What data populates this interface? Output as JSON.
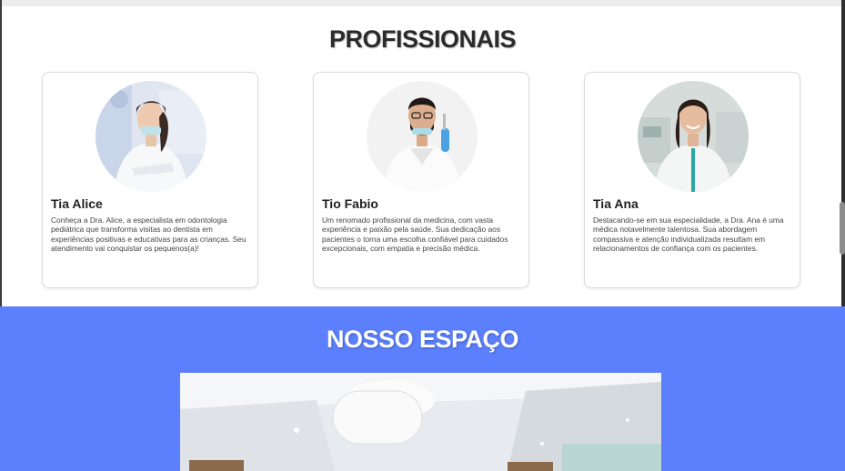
{
  "professionals": {
    "title": "PROFISSIONAIS",
    "cards": [
      {
        "name": "Tia Alice",
        "description": "Conheça a Dra. Alice, a especialista em odontologia pediátrica que transforma visitas ao dentista em experiências positivas e educativas para as crianças. Seu atendimento vai conquistar os pequenos(a)!",
        "photo_icon": "dentist-photo"
      },
      {
        "name": "Tio Fabio",
        "description": "Um renomado profissional da medicina, com vasta experiência e paixão pela saúde. Sua dedicação aos pacientes o torna uma escolha confiável para cuidados excepcionais, com empatia e precisão médica.",
        "photo_icon": "dentist-photo"
      },
      {
        "name": "Tia Ana",
        "description": "Destacando-se em sua especialidade, a Dra. Ana é uma médica notavelmente talentosa. Sua abordagem compassiva e atenção individualizada resultam em relacionamentos de confiança com os pacientes.",
        "photo_icon": "dentist-photo"
      }
    ]
  },
  "space": {
    "title": "NOSSO ESPAÇO",
    "photo_icon": "clinic-interior-photo"
  },
  "colors": {
    "accent_blue": "#5b7ffd",
    "title_dark": "#2b2b2b",
    "card_border": "#dcdcdc"
  }
}
